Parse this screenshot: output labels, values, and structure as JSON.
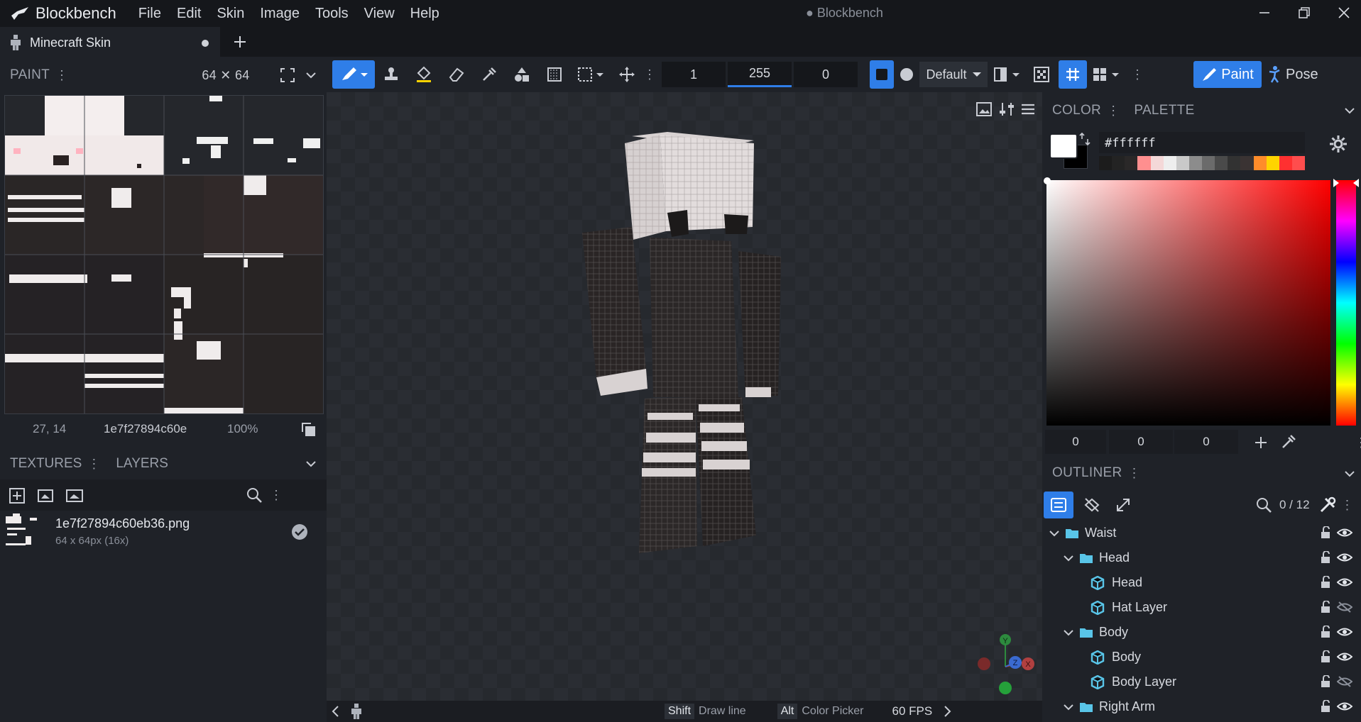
{
  "app": {
    "name": "Blockbench",
    "window_title": "● Blockbench"
  },
  "menu": [
    "File",
    "Edit",
    "Skin",
    "Image",
    "Tools",
    "View",
    "Help"
  ],
  "tabs": [
    {
      "label": "Minecraft Skin",
      "unsaved": true
    }
  ],
  "paint_panel": {
    "title": "PAINT",
    "size": "64 ✕ 64",
    "cursor": "27, 14",
    "texture_short": "1e7f27894c60e",
    "zoom": "100%"
  },
  "textures_panel": {
    "tabs": [
      "TEXTURES",
      "LAYERS"
    ],
    "item": {
      "name": "1e7f27894c60eb36.png",
      "meta": "64 x 64px (16x)"
    }
  },
  "toolbar": {
    "brush_size": "1",
    "opacity": "255",
    "softness": "0",
    "blend_mode": "Default",
    "modes": [
      "Paint",
      "Pose"
    ]
  },
  "color_panel": {
    "tabs": [
      "COLOR",
      "PALETTE"
    ],
    "hex": "#ffffff",
    "primary": "#ffffff",
    "secondary": "#000000",
    "rgb": [
      "0",
      "0",
      "0"
    ],
    "recent": [
      "#1c1c1c",
      "#232323",
      "#2a2828",
      "#ff8f8f",
      "#f4d8d8",
      "#eeeeee",
      "#c9c9c9",
      "#8c8c8c",
      "#6b6b6b",
      "#4a4a4a",
      "#323232",
      "#3a3333",
      "#ff8c2a",
      "#ffd400",
      "#ff3030",
      "#ff4d4d"
    ]
  },
  "outliner": {
    "title": "OUTLINER",
    "count": "0 / 12",
    "items": [
      {
        "label": "Waist",
        "type": "folder",
        "depth": 0,
        "visible": true
      },
      {
        "label": "Head",
        "type": "folder",
        "depth": 1,
        "visible": true
      },
      {
        "label": "Head",
        "type": "cube",
        "depth": 2,
        "visible": true
      },
      {
        "label": "Hat Layer",
        "type": "cube",
        "depth": 2,
        "visible": false
      },
      {
        "label": "Body",
        "type": "folder",
        "depth": 1,
        "visible": true
      },
      {
        "label": "Body",
        "type": "cube",
        "depth": 2,
        "visible": true
      },
      {
        "label": "Body Layer",
        "type": "cube",
        "depth": 2,
        "visible": false
      },
      {
        "label": "Right Arm",
        "type": "folder",
        "depth": 1,
        "visible": true
      }
    ]
  },
  "statusbar": {
    "hints": [
      {
        "key": "Shift",
        "label": "Draw line"
      },
      {
        "key": "Alt",
        "label": "Color Picker"
      }
    ],
    "fps": "60 FPS"
  },
  "gizmo": {
    "axes": [
      "Y",
      "Z",
      "X"
    ]
  }
}
